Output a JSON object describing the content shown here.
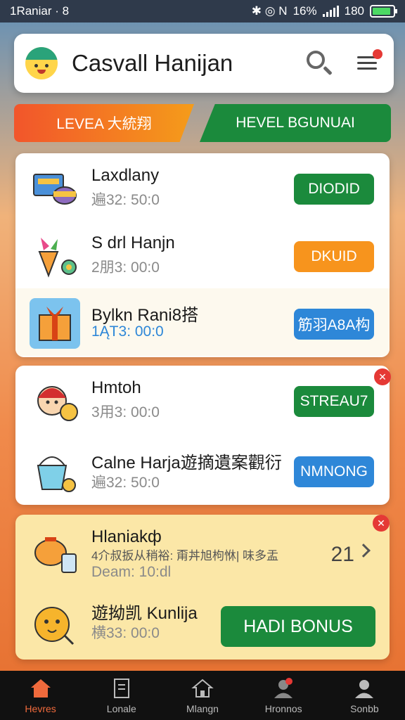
{
  "status_bar": {
    "time": "1Raniar · 8",
    "network": "✱ ◎ N",
    "battery_text": "16%",
    "battery_percent": "180",
    "battery_level": 0.9
  },
  "header": {
    "title": "Casvall Hanijan",
    "search_icon": "search-icon",
    "menu_icon": "menu-icon"
  },
  "tabs": [
    {
      "label": "LEVEA 大統翔"
    },
    {
      "label": "HEVEL BGUNUAI"
    }
  ],
  "card1": {
    "rows": [
      {
        "title": "Laxdlany",
        "subtitle": "遍32: 50:0",
        "button": "DIODID",
        "button_color": "#1b8a3c",
        "icon": "gift-box-icon"
      },
      {
        "title": "S drl Hanjn",
        "subtitle": "2朋3: 00:0",
        "button": "DKUID",
        "button_color": "#f7941d",
        "icon": "ice-cream-icon"
      },
      {
        "title": "Bylkn Rani8搭",
        "subtitle": "1ĄT3: 00:0",
        "button": "筋羽A8A构",
        "button_color": "#2e87d8",
        "icon": "present-icon"
      }
    ]
  },
  "card2": {
    "rows": [
      {
        "title": "Hmtoh",
        "subtitle": "3用3: 00:0",
        "button": "STREAU7",
        "button_color": "#1b8a3c",
        "icon": "character-icon"
      },
      {
        "title": "Calne Harja遊摘遺案觀衍",
        "subtitle": "遍32: 50:0",
        "button": "NMNONG",
        "button_color": "#2e87d8",
        "icon": "bucket-icon"
      }
    ]
  },
  "card3": {
    "row1": {
      "title": "Hlaniakф",
      "description": "4介叔扳从稍裕: 甭丼旭枸恘| 味多盂",
      "time": "Deam: 10:dl",
      "count": "21",
      "icon": "teapot-icon"
    },
    "row2": {
      "title": "遊拗凯 Kunlija",
      "subtitle": "横33: 00:0",
      "button": "HADI BONUS",
      "icon": "chick-icon"
    }
  },
  "bottom_nav": [
    {
      "label": "Hevres",
      "icon": "home-icon",
      "active": true
    },
    {
      "label": "Lonale",
      "icon": "document-icon",
      "active": false
    },
    {
      "label": "Mlangn",
      "icon": "house-icon",
      "active": false
    },
    {
      "label": "Hronnos",
      "icon": "profile-alert-icon",
      "active": false
    },
    {
      "label": "Sonbb",
      "icon": "person-icon",
      "active": false
    }
  ]
}
